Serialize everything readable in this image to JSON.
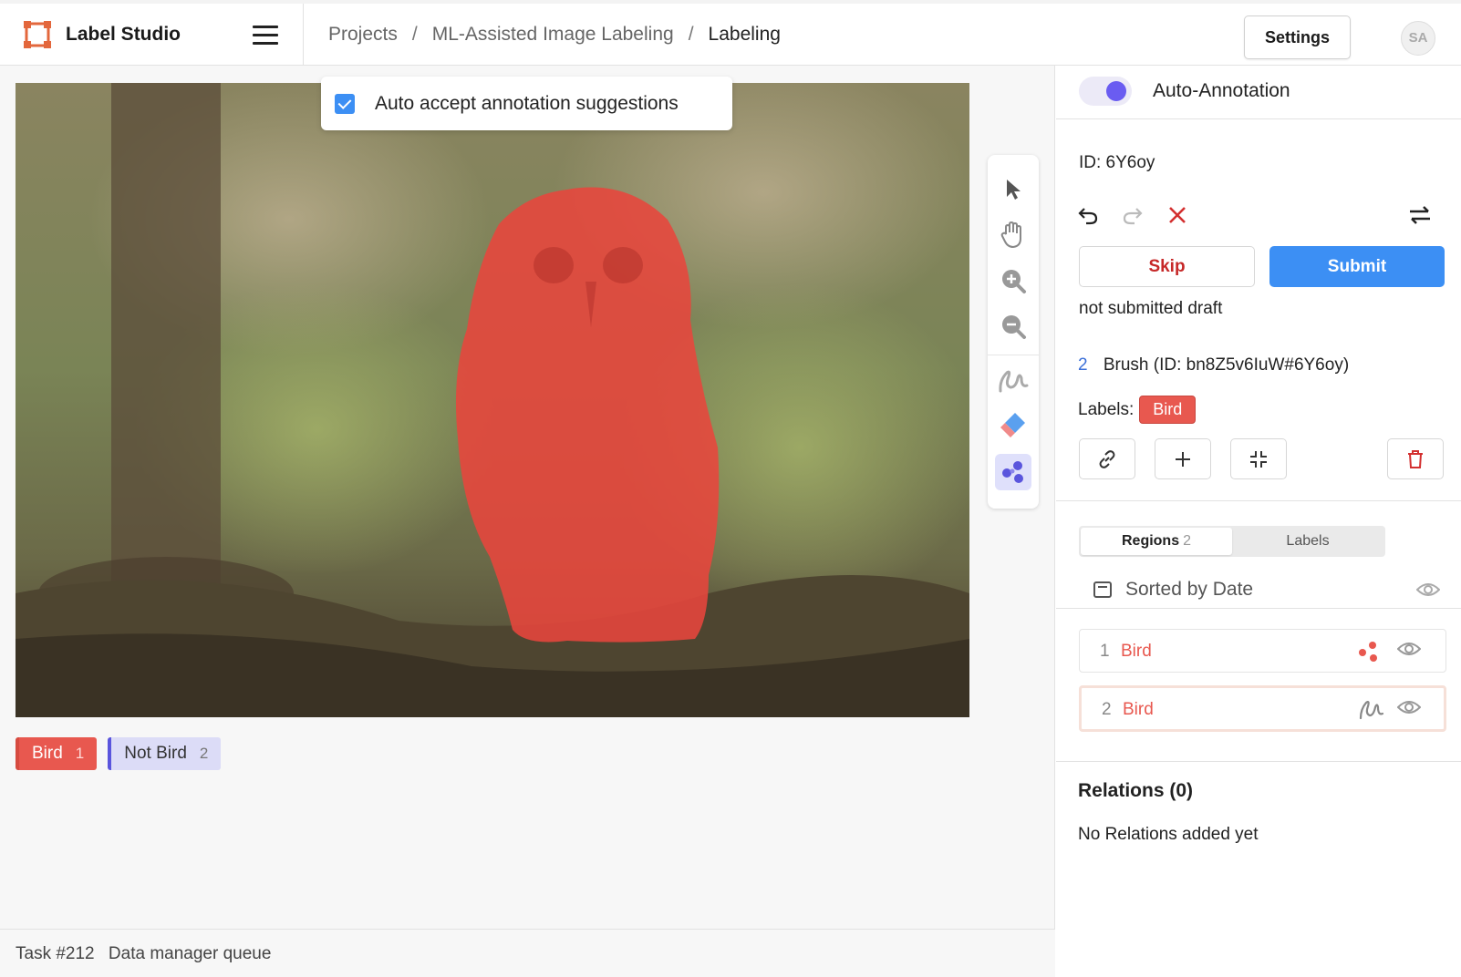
{
  "header": {
    "app_name": "Label Studio",
    "breadcrumb": [
      "Projects",
      "ML-Assisted Image Labeling",
      "Labeling"
    ],
    "breadcrumb_sep": "/",
    "settings_label": "Settings",
    "avatar_initials": "SA"
  },
  "canvas": {
    "suggest_checkbox_label": "Auto accept annotation suggestions",
    "suggest_checked": true,
    "mask_color": "#e8453c"
  },
  "tools": [
    "pointer-icon",
    "hand-icon",
    "zoom-in-icon",
    "zoom-out-icon",
    "brush-icon",
    "eraser-icon",
    "magic-wand-icon"
  ],
  "label_buttons": [
    {
      "name": "Bird",
      "hotkey": "1",
      "color": "#e8584f"
    },
    {
      "name": "Not Bird",
      "hotkey": "2",
      "color": "#5a55dd"
    }
  ],
  "footer": {
    "task": "Task #212",
    "queue": "Data manager queue"
  },
  "panel": {
    "auto_annotation_label": "Auto-Annotation",
    "auto_annotation_on": true,
    "annotation_id": "ID: 6Y6oy",
    "skip_label": "Skip",
    "submit_label": "Submit",
    "draft_status": "not submitted draft",
    "selected_region": {
      "index": "2",
      "title": "Brush (ID: bn8Z5v6IuW#6Y6oy)",
      "labels_caption": "Labels:",
      "label": "Bird"
    },
    "tabs": [
      {
        "label": "Regions",
        "count": "2",
        "active": true
      },
      {
        "label": "Labels",
        "count": "",
        "active": false
      }
    ],
    "sort_label": "Sorted by Date",
    "regions": [
      {
        "index": "1",
        "label": "Bird",
        "tool_icon": "magic-wand-icon"
      },
      {
        "index": "2",
        "label": "Bird",
        "tool_icon": "brush-icon",
        "selected": true
      }
    ],
    "relations_title": "Relations (0)",
    "relations_empty": "No Relations added yet"
  },
  "colors": {
    "accent": "#3c8ff4",
    "bird": "#e8584f",
    "not_bird": "#5a55dd",
    "toggle": "#6a5cf1"
  }
}
